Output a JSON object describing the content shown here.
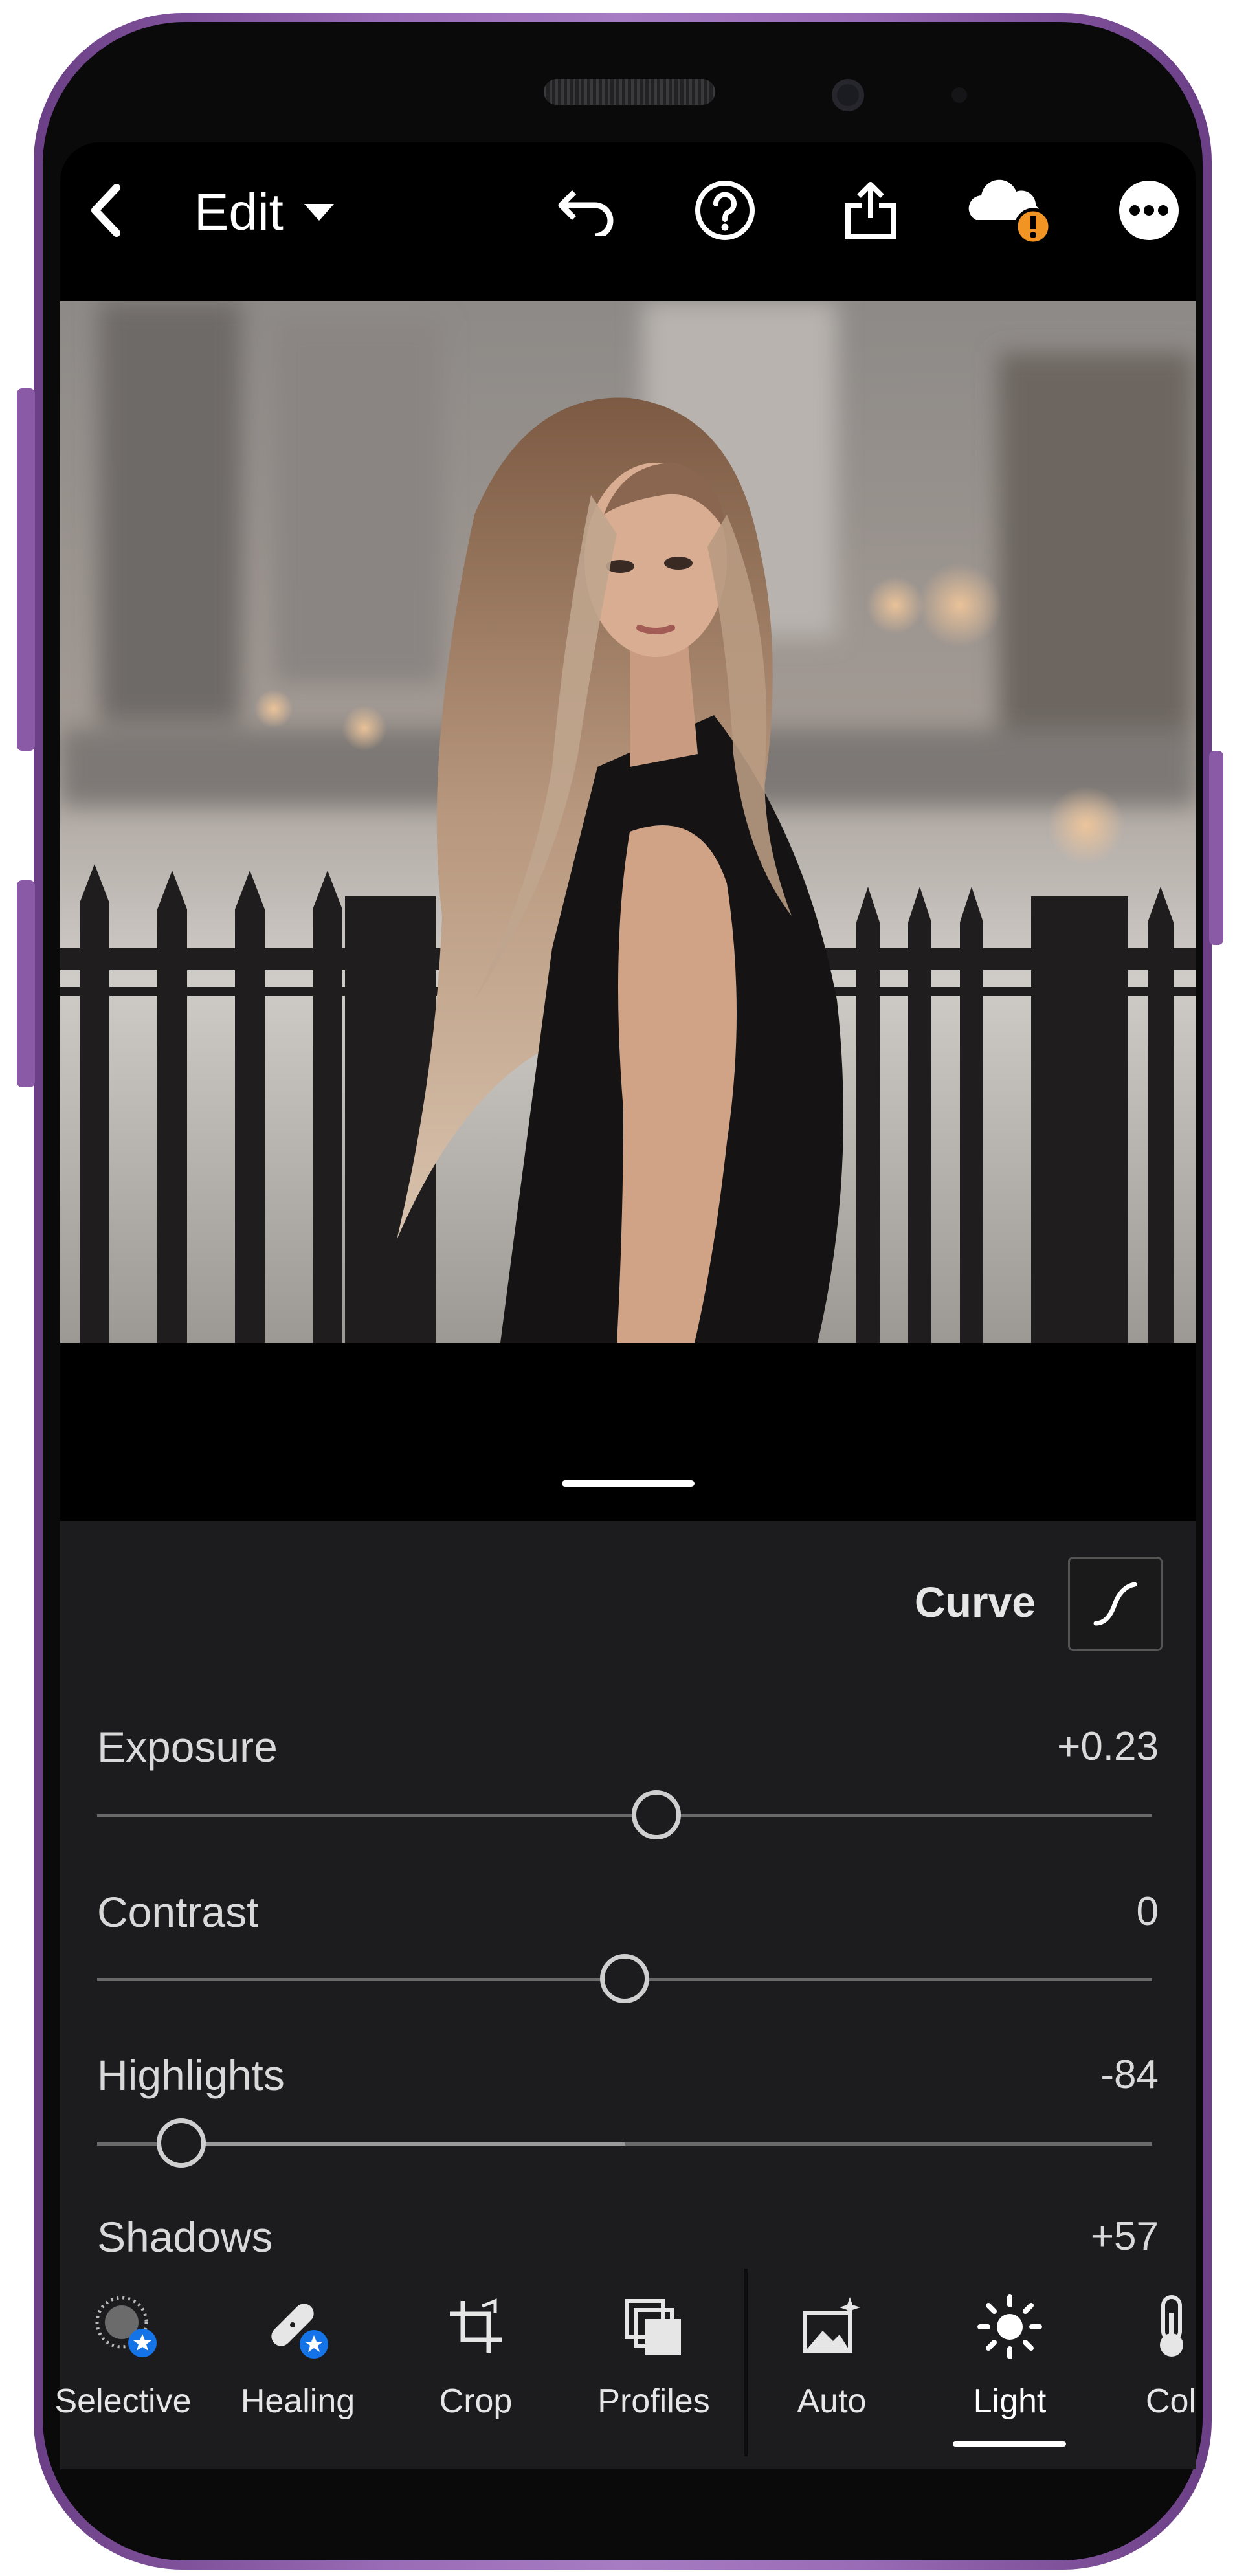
{
  "header": {
    "title": "Edit",
    "back_icon": "back-chevron-icon",
    "dropdown_icon": "caret-down-icon",
    "undo_icon": "undo-icon",
    "help_icon": "help-icon",
    "share_icon": "share-icon",
    "cloud_icon": "cloud-warning-icon",
    "more_icon": "more-icon"
  },
  "curve": {
    "label": "Curve",
    "icon": "curve-icon"
  },
  "sliders": [
    {
      "label": "Exposure",
      "value": "+0.23",
      "position": 0.53
    },
    {
      "label": "Contrast",
      "value": "0",
      "position": 0.5
    },
    {
      "label": "Highlights",
      "value": "-84",
      "position": 0.08
    },
    {
      "label": "Shadows",
      "value": "+57"
    }
  ],
  "toolbar": {
    "items": [
      {
        "label": "Selective",
        "icon": "selective-icon",
        "premium": true
      },
      {
        "label": "Healing",
        "icon": "healing-bandage-icon",
        "premium": true
      },
      {
        "label": "Crop",
        "icon": "crop-icon",
        "premium": false
      },
      {
        "label": "Profiles",
        "icon": "profiles-icon",
        "premium": false
      },
      {
        "label": "Auto",
        "icon": "auto-icon",
        "premium": false
      },
      {
        "label": "Light",
        "icon": "light-sun-icon",
        "premium": false,
        "active": true
      },
      {
        "label": "Col",
        "icon": "color-thermometer-icon",
        "premium": false
      }
    ]
  },
  "colors": {
    "panel": "#1c1c1e",
    "accent_badge": "#1473e6",
    "warning": "#f29423",
    "phone_frame": "#8a5aa7"
  }
}
